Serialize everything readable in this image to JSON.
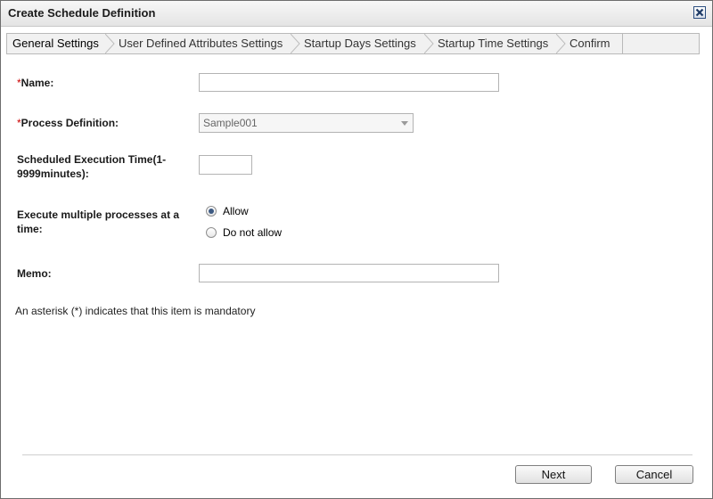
{
  "window": {
    "title": "Create Schedule Definition",
    "close_icon": "close-icon"
  },
  "tabs": [
    {
      "label": "General Settings",
      "active": true
    },
    {
      "label": "User Defined Attributes Settings",
      "active": false
    },
    {
      "label": "Startup Days Settings",
      "active": false
    },
    {
      "label": "Startup Time Settings",
      "active": false
    },
    {
      "label": "Confirm",
      "active": false
    }
  ],
  "form": {
    "required_marker": "*",
    "name": {
      "label": "Name:",
      "value": ""
    },
    "process_definition": {
      "label": "Process Definition:",
      "selected": "Sample001"
    },
    "execution_time": {
      "label_line1": "Scheduled Execution Time(1-",
      "label_line2": "9999minutes):",
      "value": ""
    },
    "multiple": {
      "label_line1": "Execute multiple processes at a",
      "label_line2": "time:",
      "options": [
        {
          "label": "Allow",
          "checked": true
        },
        {
          "label": "Do not allow",
          "checked": false
        }
      ]
    },
    "memo": {
      "label": "Memo:",
      "value": ""
    },
    "note": "An asterisk (*) indicates that this item is mandatory"
  },
  "buttons": {
    "next": "Next",
    "cancel": "Cancel"
  },
  "colors": {
    "required": "#cc0000",
    "radio_selected": "#3d5a82"
  }
}
